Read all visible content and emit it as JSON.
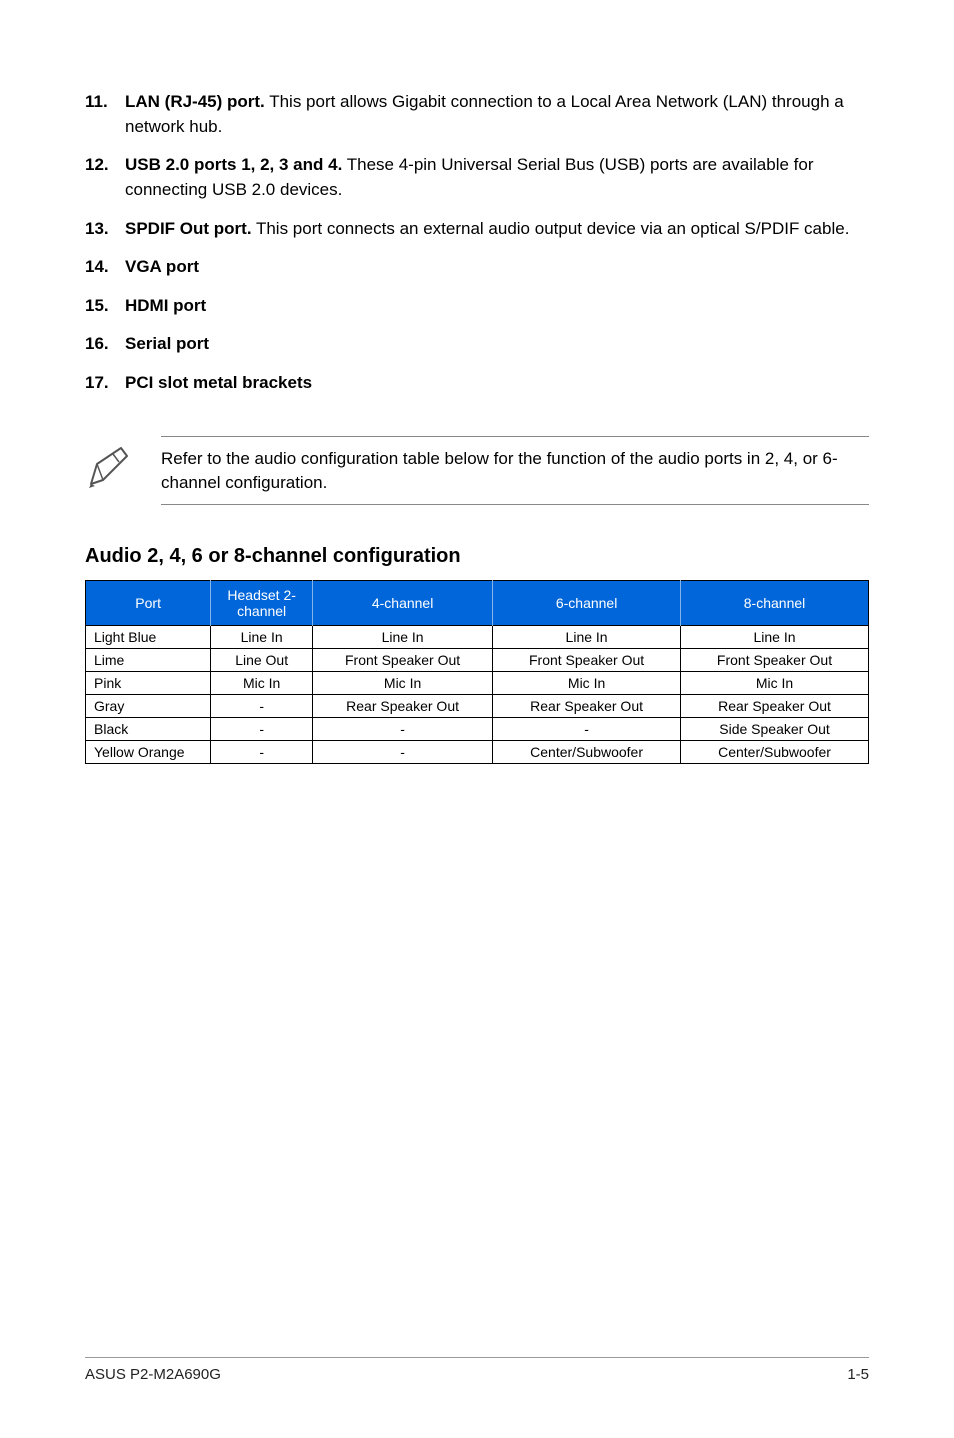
{
  "items": [
    {
      "num": "11.",
      "bold": "LAN (RJ-45) port.",
      "rest": " This port allows Gigabit connection to a Local Area Network (LAN) through a network hub."
    },
    {
      "num": "12.",
      "bold": "USB 2.0 ports 1, 2, 3 and 4.",
      "rest": " These 4-pin Universal Serial Bus (USB) ports are available for connecting USB 2.0 devices."
    },
    {
      "num": "13.",
      "bold": "SPDIF Out port.",
      "rest": " This port connects an external audio output device via an optical S/PDIF cable."
    },
    {
      "num": "14.",
      "bold": "VGA port",
      "rest": ""
    },
    {
      "num": "15.",
      "bold": "HDMI port",
      "rest": ""
    },
    {
      "num": "16.",
      "bold": "Serial port",
      "rest": ""
    },
    {
      "num": "17.",
      "bold": "PCI slot metal brackets",
      "rest": ""
    }
  ],
  "note_text": "Refer to the audio configuration table below for the function of the audio ports in 2, 4, or 6-channel configuration.",
  "section_heading": "Audio 2, 4, 6 or 8-channel configuration",
  "table": {
    "headers": [
      "Port",
      "Headset 2-channel",
      "4-channel",
      "6-channel",
      "8-channel"
    ],
    "rows": [
      [
        "Light Blue",
        "Line In",
        "Line In",
        "Line In",
        "Line In"
      ],
      [
        "Lime",
        "Line Out",
        "Front Speaker Out",
        "Front Speaker Out",
        "Front Speaker Out"
      ],
      [
        "Pink",
        "Mic In",
        "Mic In",
        "Mic In",
        "Mic In"
      ],
      [
        "Gray",
        "-",
        "Rear Speaker Out",
        "Rear Speaker Out",
        "Rear Speaker Out"
      ],
      [
        "Black",
        "-",
        "-",
        "-",
        "Side Speaker Out"
      ],
      [
        "Yellow Orange",
        "-",
        "-",
        "Center/Subwoofer",
        "Center/Subwoofer"
      ]
    ]
  },
  "footer_left": "ASUS P2-M2A690G",
  "footer_right": "1-5"
}
